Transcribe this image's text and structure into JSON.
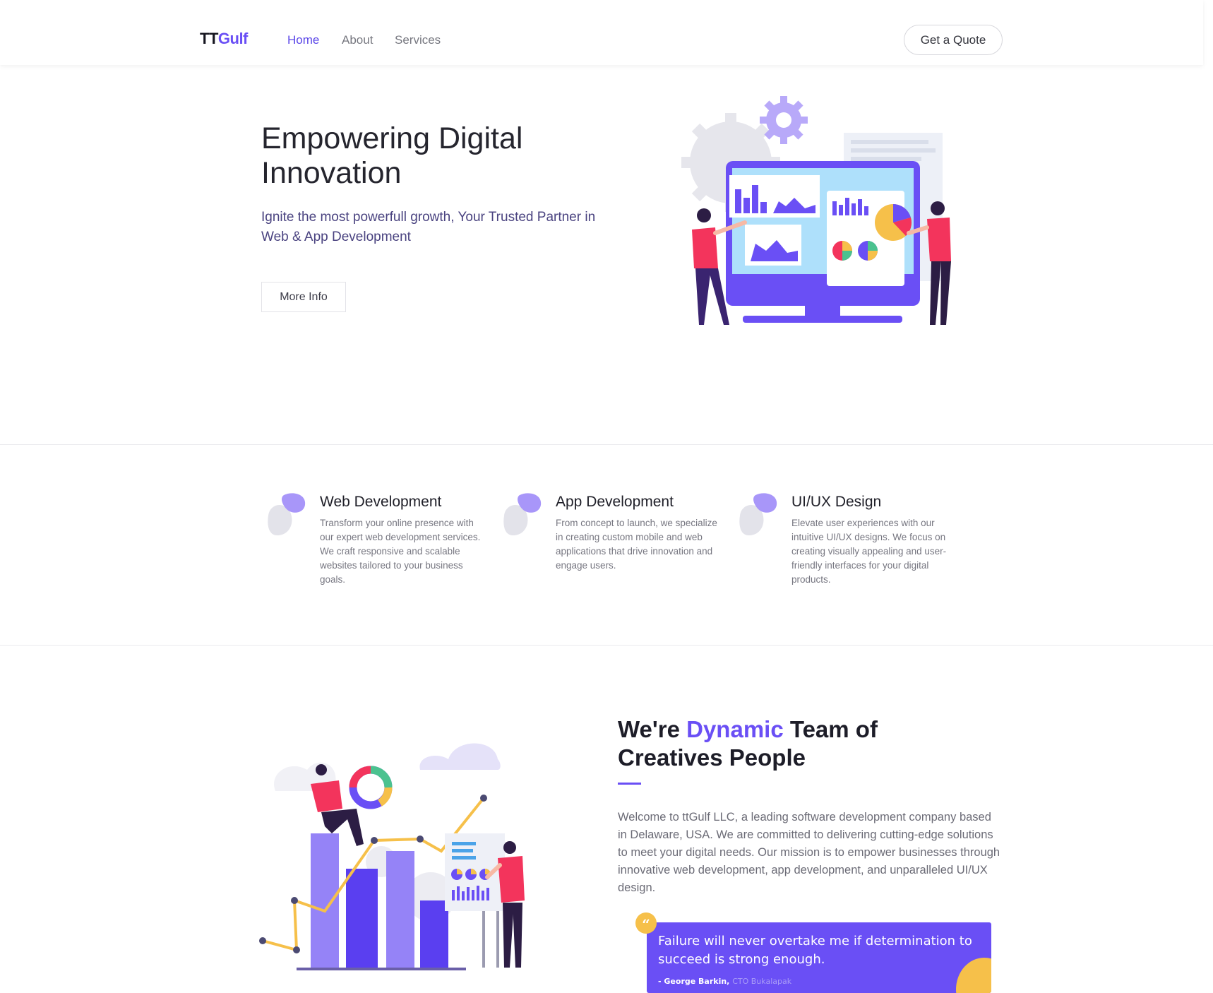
{
  "navbar": {
    "brand_part1": "TT",
    "brand_part2": "Gulf",
    "links": [
      {
        "label": "Home",
        "active": true
      },
      {
        "label": "About",
        "active": false
      },
      {
        "label": "Services",
        "active": false
      }
    ],
    "quote_button": "Get a Quote"
  },
  "hero": {
    "title": "Empowering Digital Innovation",
    "subtitle": "Ignite the most powerfull growth, Your Trusted Partner in Web & App Development",
    "button": "More Info",
    "illustration_icon": "analytics-dashboard-illustration"
  },
  "services": [
    {
      "title": "Web Development",
      "description": "Transform your online presence with our expert web development services. We craft responsive and scalable websites tailored to your business goals.",
      "icon": "blob-icon"
    },
    {
      "title": "App Development",
      "description": "From concept to launch, we specialize in creating custom mobile and web applications that drive innovation and engage users.",
      "icon": "blob-icon"
    },
    {
      "title": "UI/UX Design",
      "description": "Elevate user experiences with our intuitive UI/UX designs. We focus on creating visually appealing and user-friendly interfaces for your digital products.",
      "icon": "blob-icon"
    }
  ],
  "about": {
    "title_pre": "We're ",
    "title_highlight": "Dynamic",
    "title_post": " Team of Creatives People",
    "text": "Welcome to ttGulf LLC, a leading software development company based in Delaware, USA. We are committed to delivering cutting-edge solutions to meet your digital needs. Our mission is to empower businesses through innovative web development, app development, and unparalleled UI/UX design.",
    "quote_mark": "“",
    "quote": "Failure will never overtake me if determination to succeed is strong enough.",
    "quote_author": "- George Barkin,",
    "quote_role": "CTO Bukalapak",
    "illustration_icon": "team-growth-illustration"
  },
  "colors": {
    "accent": "#6a4ff5",
    "highlight": "#f6c04a",
    "pink": "#f3345c"
  }
}
